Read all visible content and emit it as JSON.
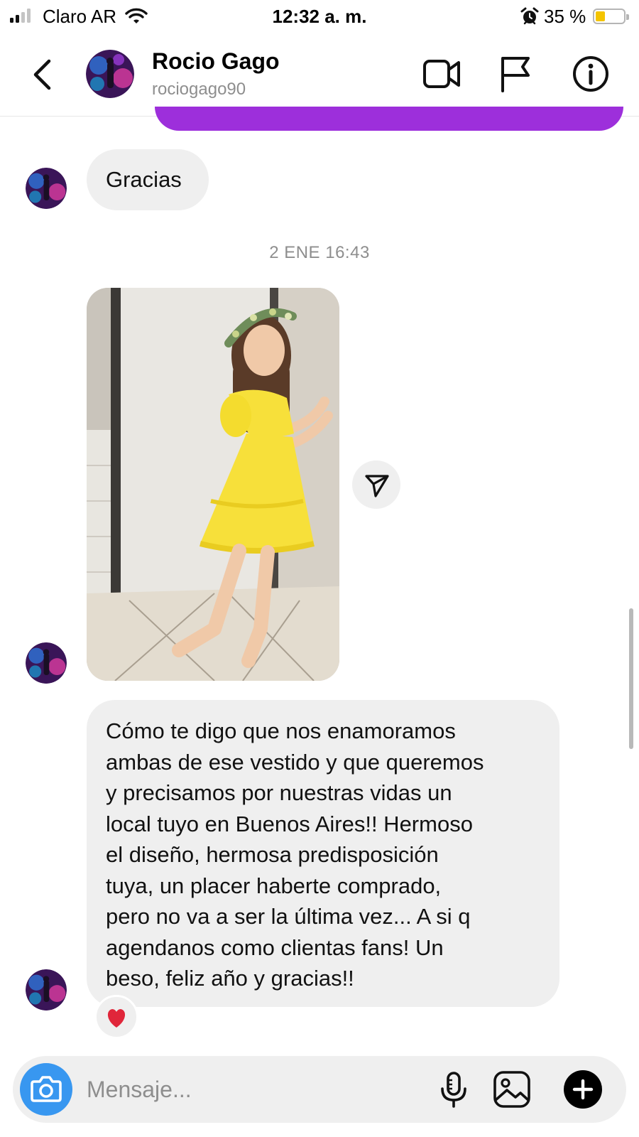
{
  "status_bar": {
    "carrier": "Claro AR",
    "time": "12:32 a. m.",
    "battery_percent": "35 %",
    "battery_level": 0.35,
    "battery_color": "#f4c400",
    "signal_bars_active": 2,
    "signal_bars_total": 4,
    "icons": [
      "signal-icon",
      "wifi-icon",
      "alarm-icon",
      "battery-icon"
    ]
  },
  "header": {
    "name": "Rocio Gago",
    "username": "rociogago90",
    "icons": [
      "back-chevron-icon",
      "video-call-icon",
      "flag-icon",
      "info-icon"
    ]
  },
  "messages": {
    "thanks_text": "Gracias",
    "timestamp": "2 ENE 16:43",
    "long_text": "Cómo te digo que nos enamoramos\nambas de ese vestido y que queremos\ny precisamos por nuestras vidas un\nlocal tuyo en Buenos Aires!! Hermoso\nel diseño, hermosa predisposición\ntuya, un placer haberte comprado,\npero no va a ser la última vez... A si q\nagendanos como clientas fans! Un\nbeso, feliz año y gracias!!",
    "reaction": "❤️",
    "outgoing_bubble_color": "#9d2fdb",
    "incoming_bubble_color": "#efefef"
  },
  "composer": {
    "placeholder": "Mensaje...",
    "value": "",
    "camera_color": "#3897f0",
    "icons": [
      "camera-icon",
      "microphone-icon",
      "gallery-icon",
      "plus-icon"
    ]
  }
}
